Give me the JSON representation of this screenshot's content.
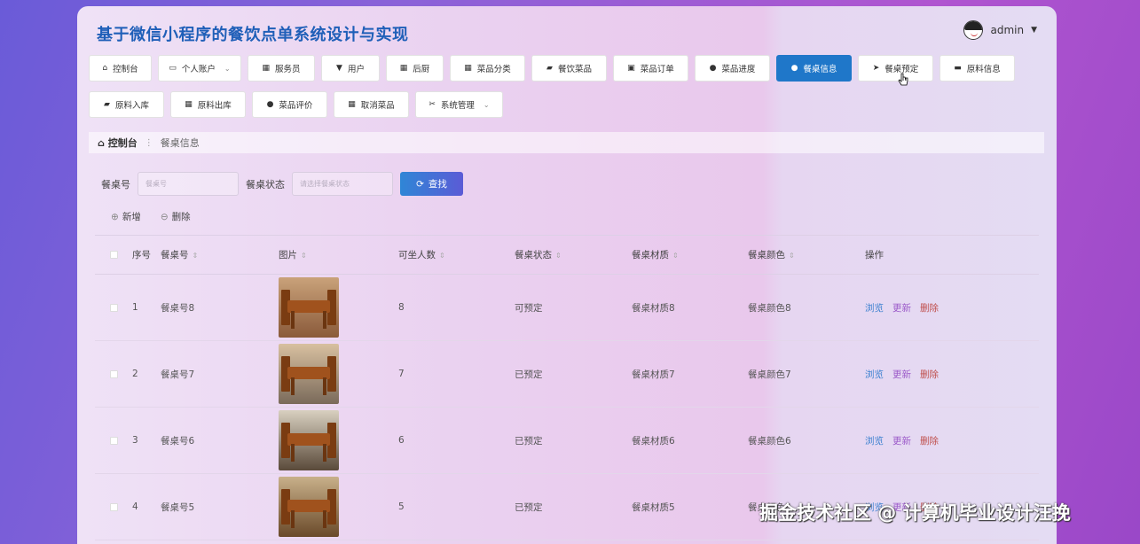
{
  "app": {
    "title": "基于微信小程序的餐饮点单系统设计与实现"
  },
  "user": {
    "name": "admin"
  },
  "nav": [
    {
      "label": "控制台",
      "icon": "home-icon",
      "glyph": "⌂",
      "width": 71
    },
    {
      "label": "个人账户",
      "icon": "account-icon",
      "glyph": "▭",
      "width": 94,
      "dropdown": true
    },
    {
      "label": "服务员",
      "icon": "grid-icon",
      "glyph": "▦",
      "width": 76
    },
    {
      "label": "用户",
      "icon": "user-icon",
      "glyph": "▼",
      "width": 66
    },
    {
      "label": "后厨",
      "icon": "grid-icon",
      "glyph": "▦",
      "width": 65
    },
    {
      "label": "菜品分类",
      "icon": "grid-icon",
      "glyph": "▦",
      "width": 85
    },
    {
      "label": "餐饮菜品",
      "icon": "folder-icon",
      "glyph": "▰",
      "width": 85
    },
    {
      "label": "菜品订单",
      "icon": "clipboard-icon",
      "glyph": "▣",
      "width": 85
    },
    {
      "label": "菜品进度",
      "icon": "pin-icon",
      "glyph": "●",
      "width": 85
    },
    {
      "label": "餐桌信息",
      "icon": "user-icon",
      "glyph": "●",
      "width": 85,
      "active": true
    },
    {
      "label": "餐桌预定",
      "icon": "send-icon",
      "glyph": "➤",
      "width": 85
    },
    {
      "label": "原料信息",
      "icon": "monitor-icon",
      "glyph": "▬",
      "width": 85
    },
    {
      "label": "原料入库",
      "icon": "briefcase-icon",
      "glyph": "▰",
      "width": 85
    },
    {
      "label": "原料出库",
      "icon": "grid-icon",
      "glyph": "▦",
      "width": 85
    },
    {
      "label": "菜品评价",
      "icon": "user-icon",
      "glyph": "●",
      "width": 85
    },
    {
      "label": "取消菜品",
      "icon": "grid-icon",
      "glyph": "▦",
      "width": 85
    },
    {
      "label": "系统管理",
      "icon": "gear-icon",
      "glyph": "✂",
      "width": 99,
      "dropdown": true
    }
  ],
  "breadcrumb": {
    "home": "控制台",
    "sep": "⋮",
    "current": "餐桌信息"
  },
  "search": {
    "table_no_label": "餐桌号",
    "table_no_placeholder": "餐桌号",
    "status_label": "餐桌状态",
    "status_placeholder": "请选择餐桌状态",
    "button": "查找"
  },
  "actions": {
    "add": "新增",
    "delete": "删除"
  },
  "table": {
    "headers": [
      "序号",
      "餐桌号",
      "图片",
      "可坐人数",
      "餐桌状态",
      "餐桌材质",
      "餐桌颜色",
      "操作"
    ],
    "rows": [
      {
        "idx": "1",
        "no": "餐桌号8",
        "seats": "8",
        "status": "可预定",
        "material": "餐桌材质8",
        "color": "餐桌颜色8"
      },
      {
        "idx": "2",
        "no": "餐桌号7",
        "seats": "7",
        "status": "已预定",
        "material": "餐桌材质7",
        "color": "餐桌颜色7"
      },
      {
        "idx": "3",
        "no": "餐桌号6",
        "seats": "6",
        "status": "已预定",
        "material": "餐桌材质6",
        "color": "餐桌颜色6"
      },
      {
        "idx": "4",
        "no": "餐桌号5",
        "seats": "5",
        "status": "已预定",
        "material": "餐桌材质5",
        "color": "餐桌颜色5"
      }
    ],
    "row_actions": {
      "view": "浏览",
      "edit": "更新",
      "delete": "删除"
    }
  },
  "watermark": "掘金技术社区 @ 计算机毕业设计汪挽",
  "colors": {
    "accent": "#1f77c9",
    "title": "#1f5fb8",
    "view": "#3b80d0",
    "edit": "#9b59c9",
    "delete": "#c0504d"
  }
}
